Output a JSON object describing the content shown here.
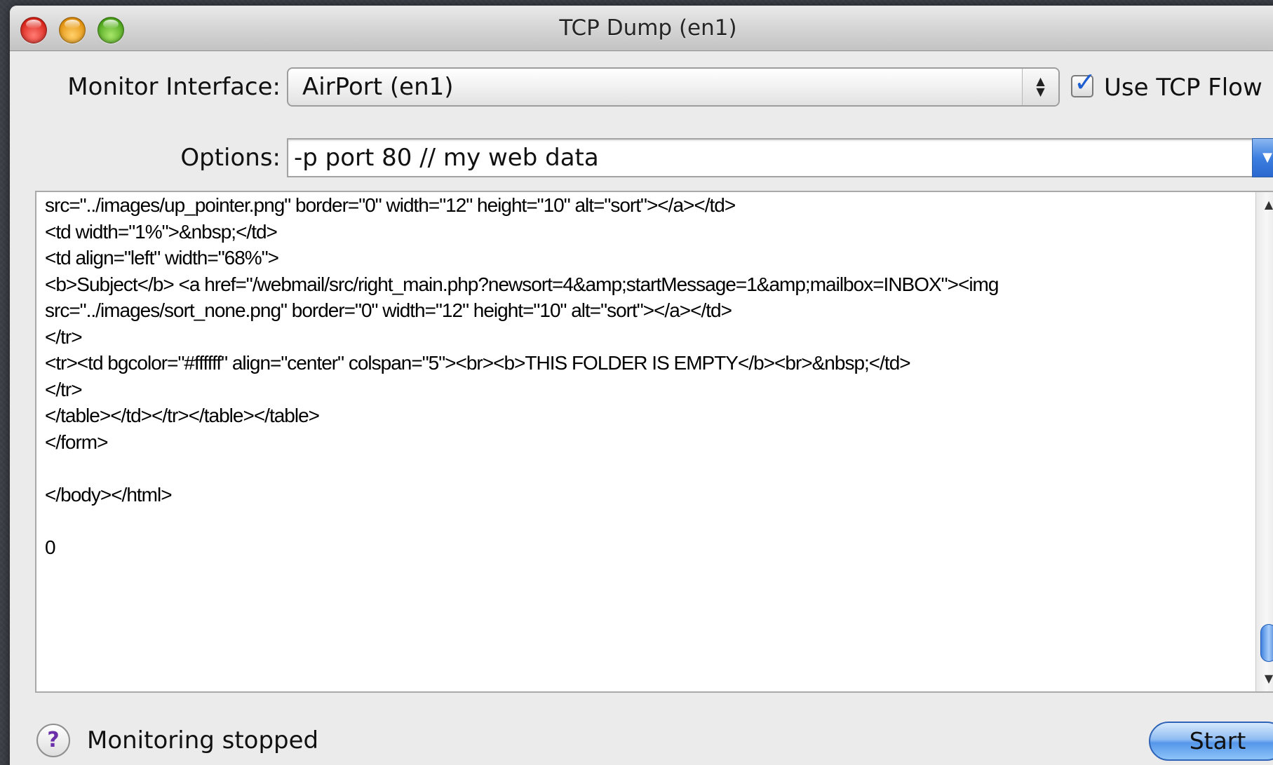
{
  "window": {
    "title": "TCP Dump (en1)"
  },
  "interface": {
    "label": "Monitor Interface:",
    "selected": "AirPort (en1)",
    "use_tcp_flow_label": "Use TCP Flow",
    "use_tcp_flow_checked": true
  },
  "options": {
    "label": "Options:",
    "value": "-p port 80 // my web data"
  },
  "log": {
    "lines": [
      "src=\"../images/up_pointer.png\" border=\"0\" width=\"12\" height=\"10\" alt=\"sort\"></a></td>",
      "<td width=\"1%\">&nbsp;</td>",
      "<td align=\"left\" width=\"68%\">",
      "<b>Subject</b> <a href=\"/webmail/src/right_main.php?newsort=4&amp;startMessage=1&amp;mailbox=INBOX\"><img",
      "src=\"../images/sort_none.png\" border=\"0\" width=\"12\" height=\"10\" alt=\"sort\"></a></td>",
      "</tr>",
      "<tr><td bgcolor=\"#ffffff\" align=\"center\" colspan=\"5\"><br><b>THIS FOLDER IS EMPTY</b><br>&nbsp;</td>",
      "</tr>",
      "</table></td></tr></table></table>",
      "</form>",
      "",
      "</body></html>",
      "",
      "0"
    ]
  },
  "status": {
    "text": "Monitoring stopped",
    "help_symbol": "?"
  },
  "actions": {
    "start_label": "Start"
  },
  "icons": {
    "close": "traffic-light-close-icon",
    "minimize": "traffic-light-minimize-icon",
    "zoom": "traffic-light-zoom-icon",
    "popup_arrows": "up-down-arrows-icon",
    "combo_arrow": "chevron-down-icon",
    "scroll_up": "scroll-up-arrow-icon",
    "scroll_down": "scroll-down-arrow-icon",
    "help": "help-icon",
    "checkmark": "checkmark-icon"
  },
  "colors": {
    "accent": "#3d7fe0",
    "window_bg": "#ebebeb",
    "desktop_bg": "#3d4148"
  }
}
